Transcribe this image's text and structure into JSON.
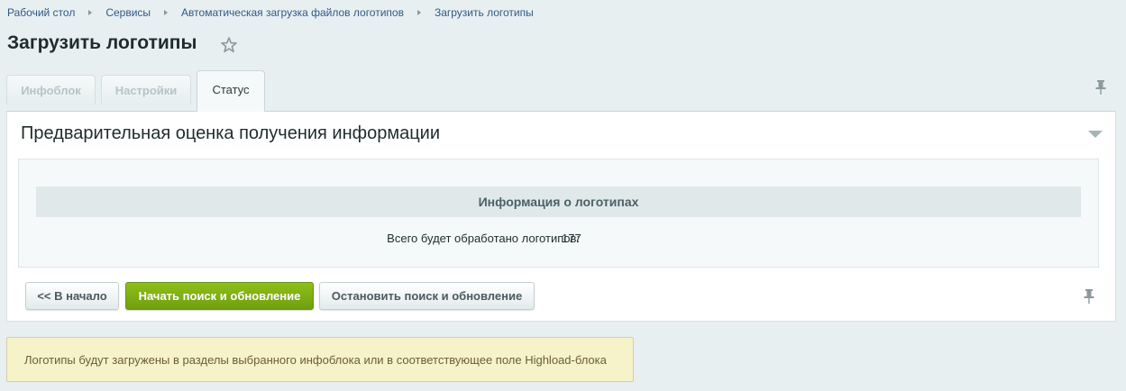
{
  "breadcrumb": [
    "Рабочий стол",
    "Сервисы",
    "Автоматическая загрузка файлов логотипов",
    "Загрузить логотипы"
  ],
  "page": {
    "title": "Загрузить логотипы"
  },
  "tabs": [
    {
      "label": "Инфоблок",
      "active": false
    },
    {
      "label": "Настройки",
      "active": false
    },
    {
      "label": "Статус",
      "active": true
    }
  ],
  "section": {
    "title": "Предварительная оценка получения информации",
    "info_header": "Информация о логотипах",
    "info_label": "Всего будет обработано логотипов:",
    "info_value": "177"
  },
  "buttons": {
    "back": "<< В начало",
    "start": "Начать поиск и обновление",
    "stop": "Остановить поиск и обновление"
  },
  "note": "Логотипы будут загружены в разделы выбранного инфоблока или в соответствующее поле Highload-блока",
  "icons": [
    "star-icon",
    "pin-icon",
    "collapse-icon"
  ],
  "colors": {
    "accent_green": "#7cab13",
    "link": "#2f5a88",
    "note_bg": "#f6f2c9"
  }
}
